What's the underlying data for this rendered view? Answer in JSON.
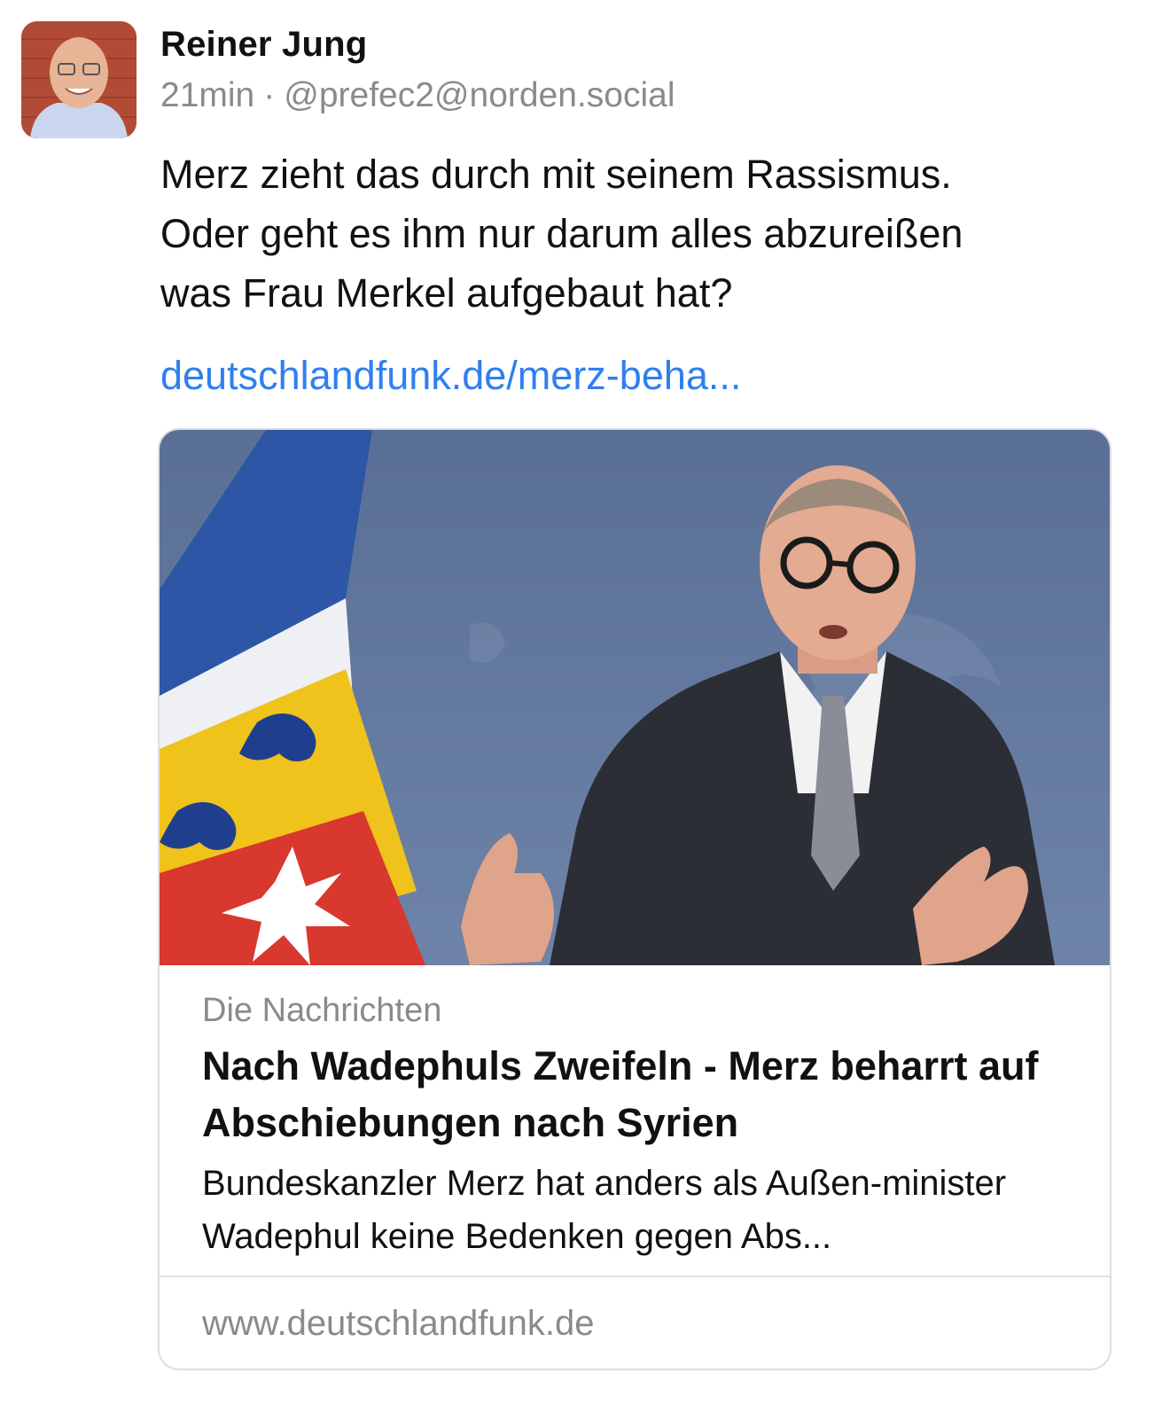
{
  "author": {
    "display_name": "Reiner Jung",
    "time_ago": "21min",
    "separator": "·",
    "handle": "@prefec2@norden.social"
  },
  "post": {
    "text": "Merz zieht das durch mit seinem Rassismus.\nOder geht es ihm nur darum alles abzureißen\nwas Frau Merkel aufgebaut hat?",
    "link_text": "deutschlandfunk.de/merz-beha..."
  },
  "link_card": {
    "source": "Die Nachrichten",
    "title": "Nach Wadephuls Zweifeln - Merz beharrt auf Abschiebungen nach Syrien",
    "description": "Bundeskanzler Merz hat anders als Außen-minister Wadephul keine Bedenken gegen Abs...",
    "domain": "www.deutschlandfunk.de"
  },
  "colors": {
    "link": "#2f7ff0",
    "secondary_text": "#8a8a8e"
  }
}
